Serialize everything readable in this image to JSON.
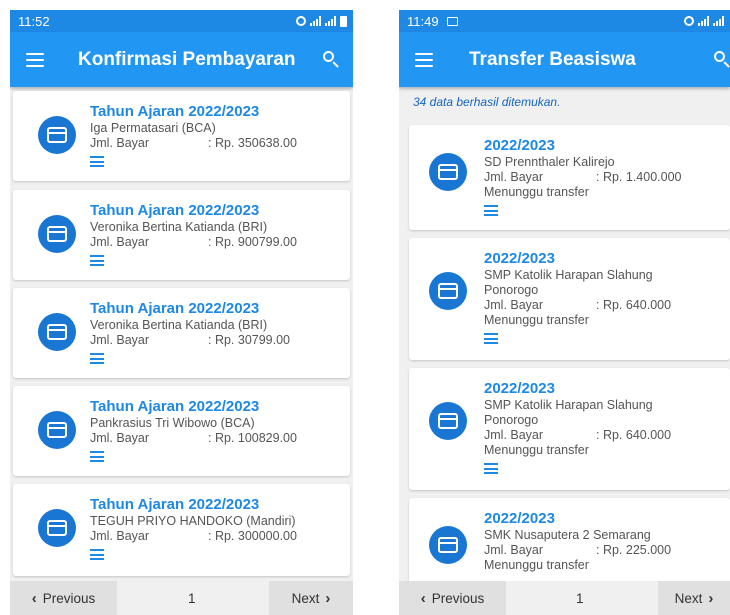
{
  "left": {
    "status_time": "11:52",
    "title": "Konfirmasi Pembayaran",
    "cards": [
      {
        "title": "Tahun Ajaran 2022/2023",
        "name": "Iga Permatasari (BCA)",
        "label": "Jml. Bayar",
        "value": ": Rp. 350638.00"
      },
      {
        "title": "Tahun Ajaran 2022/2023",
        "name": "Veronika Bertina Katianda (BRI)",
        "label": "Jml. Bayar",
        "value": ": Rp. 900799.00"
      },
      {
        "title": "Tahun Ajaran 2022/2023",
        "name": "Veronika Bertina Katianda (BRI)",
        "label": "Jml. Bayar",
        "value": ": Rp. 30799.00"
      },
      {
        "title": "Tahun Ajaran 2022/2023",
        "name": "Pankrasius Tri Wibowo (BCA)",
        "label": "Jml. Bayar",
        "value": ": Rp. 100829.00"
      },
      {
        "title": "Tahun Ajaran 2022/2023",
        "name": "TEGUH PRIYO HANDOKO (Mandiri)",
        "label": "Jml. Bayar",
        "value": ": Rp. 300000.00"
      }
    ],
    "prev_label": "Previous",
    "page": "1",
    "next_label": "Next"
  },
  "right": {
    "status_time": "11:49",
    "title": "Transfer Beasiswa",
    "result_count": "34 data berhasil ditemukan.",
    "cards": [
      {
        "title": "2022/2023",
        "name": "SD Prennthaler Kalirejo",
        "name2": "",
        "label": "Jml. Bayar",
        "value": ": Rp. 1.400.000",
        "status": "Menunggu transfer"
      },
      {
        "title": "2022/2023",
        "name": "SMP Katolik Harapan Slahung",
        "name2": "Ponorogo",
        "label": "Jml. Bayar",
        "value": ": Rp. 640.000",
        "status": "Menunggu transfer"
      },
      {
        "title": "2022/2023",
        "name": "SMP Katolik Harapan Slahung",
        "name2": "Ponorogo",
        "label": "Jml. Bayar",
        "value": ": Rp. 640.000",
        "status": "Menunggu transfer"
      },
      {
        "title": "2022/2023",
        "name": "SMK Nusaputera 2 Semarang",
        "name2": "",
        "label": "Jml. Bayar",
        "value": ": Rp. 225.000",
        "status": "Menunggu transfer"
      }
    ],
    "prev_label": "Previous",
    "page": "1",
    "next_label": "Next"
  },
  "colors": {
    "primary": "#2196f3",
    "statusbar": "#1e88e5",
    "icon": "#1976d2",
    "title_text": "#1e88e5"
  },
  "icons": {
    "menu": "hamburger-icon",
    "search": "search-icon",
    "card": "credit-card-icon",
    "detail": "list-icon"
  }
}
